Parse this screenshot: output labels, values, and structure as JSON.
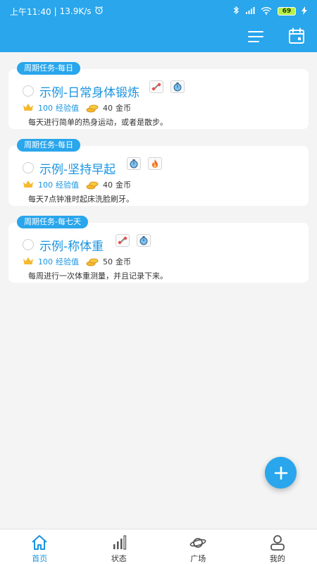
{
  "status_bar": {
    "time": "上午11:40",
    "net_speed": "13.9K/s",
    "battery": "69"
  },
  "tasks": [
    {
      "chip": "周期任务-每日",
      "title": "示例-日常身体锻炼",
      "badges": [
        "dumbbell-icon",
        "stopwatch-icon"
      ],
      "exp_value": "100",
      "exp_label": "经验值",
      "gold_value": "40",
      "gold_label": "金币",
      "description": "每天进行简单的热身运动，或者是散步。"
    },
    {
      "chip": "周期任务-每日",
      "title": "示例-坚持早起",
      "badges": [
        "stopwatch-icon",
        "fire-icon"
      ],
      "exp_value": "100",
      "exp_label": "经验值",
      "gold_value": "40",
      "gold_label": "金币",
      "description": "每天7点钟准时起床洗脸刷牙。"
    },
    {
      "chip": "周期任务-每七天",
      "title": "示例-称体重",
      "badges": [
        "dumbbell-icon",
        "stopwatch-icon"
      ],
      "exp_value": "100",
      "exp_label": "经验值",
      "gold_value": "50",
      "gold_label": "金币",
      "description": "每周进行一次体重测量，并且记录下来。"
    }
  ],
  "bottom_nav": [
    {
      "label": "首页",
      "icon": "home-icon",
      "active": true
    },
    {
      "label": "状态",
      "icon": "bar-chart-icon",
      "active": false
    },
    {
      "label": "广场",
      "icon": "planet-icon",
      "active": false
    },
    {
      "label": "我的",
      "icon": "person-icon",
      "active": false
    }
  ],
  "colors": {
    "primary": "#29a6ec",
    "title_blue": "#1a94e0",
    "background": "#f4f4f4"
  }
}
